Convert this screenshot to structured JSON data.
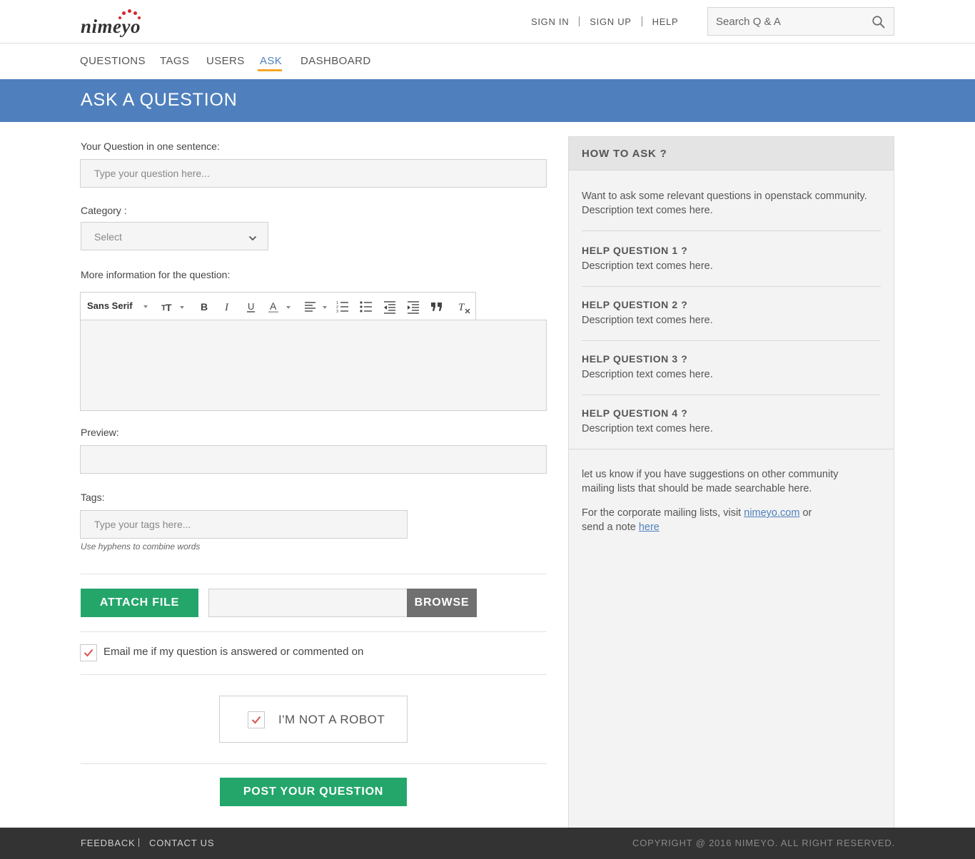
{
  "brand": {
    "name": "nimeyo",
    "dot_color": "#d3272a"
  },
  "header": {
    "links": [
      "SIGN IN",
      "SIGN UP",
      "HELP"
    ],
    "search_placeholder": "Search Q & A"
  },
  "nav": {
    "items": [
      "QUESTIONS",
      "TAGS",
      "USERS",
      "ASK",
      "DASHBOARD"
    ],
    "active": "ASK",
    "accent": "#f5a623"
  },
  "page_title": "ASK A QUESTION",
  "form": {
    "question_label": "Your Question in one sentence:",
    "question_placeholder": "Type your question here...",
    "category_label": "Category :",
    "category_value": "Select",
    "more_info_label": "More information for the question:",
    "editor_font": "Sans Serif",
    "preview_label": "Preview:",
    "tags_label": "Tags:",
    "tags_placeholder": "Type your tags here...",
    "tags_hint": "Use hyphens to combine words",
    "attach_label": "ATTACH FILE",
    "browse_label": "BROWSE",
    "email_label": "Email me if my question is answered or commented on",
    "email_checked": true,
    "captcha_label": "I'M NOT A ROBOT",
    "captcha_checked": true,
    "post_label": "POST YOUR QUESTION"
  },
  "sidebar": {
    "title": "HOW TO ASK ?",
    "intro": "Want to ask some relevant questions in openstack community. Description text comes here.",
    "help": [
      {
        "title": "HELP QUESTION 1 ?",
        "text": "Description text comes here."
      },
      {
        "title": "HELP QUESTION 2 ?",
        "text": "Description text comes here."
      },
      {
        "title": "HELP QUESTION 3 ?",
        "text": "Description text comes here."
      },
      {
        "title": "HELP QUESTION 4 ?",
        "text": "Description text comes here."
      }
    ],
    "suggest": "let us know if you have suggestions on other community mailing lists that should be made searchable here.",
    "corp_prefix": "For the corporate mailing lists, visit",
    "corp_link": "nimeyo.com",
    "corp_mid": "or",
    "corp_note": "send a note",
    "corp_here": "here"
  },
  "footer": {
    "links": [
      "FEEDBACK",
      "CONTACT US"
    ],
    "copyright": "COPYRIGHT @ 2016 NIMEYO. ALL RIGHT RESERVED."
  },
  "colors": {
    "band": "#4f80bd",
    "primary_button": "#24a66b",
    "browse_button": "#707070",
    "check": "#d9534f",
    "footer": "#333333"
  }
}
